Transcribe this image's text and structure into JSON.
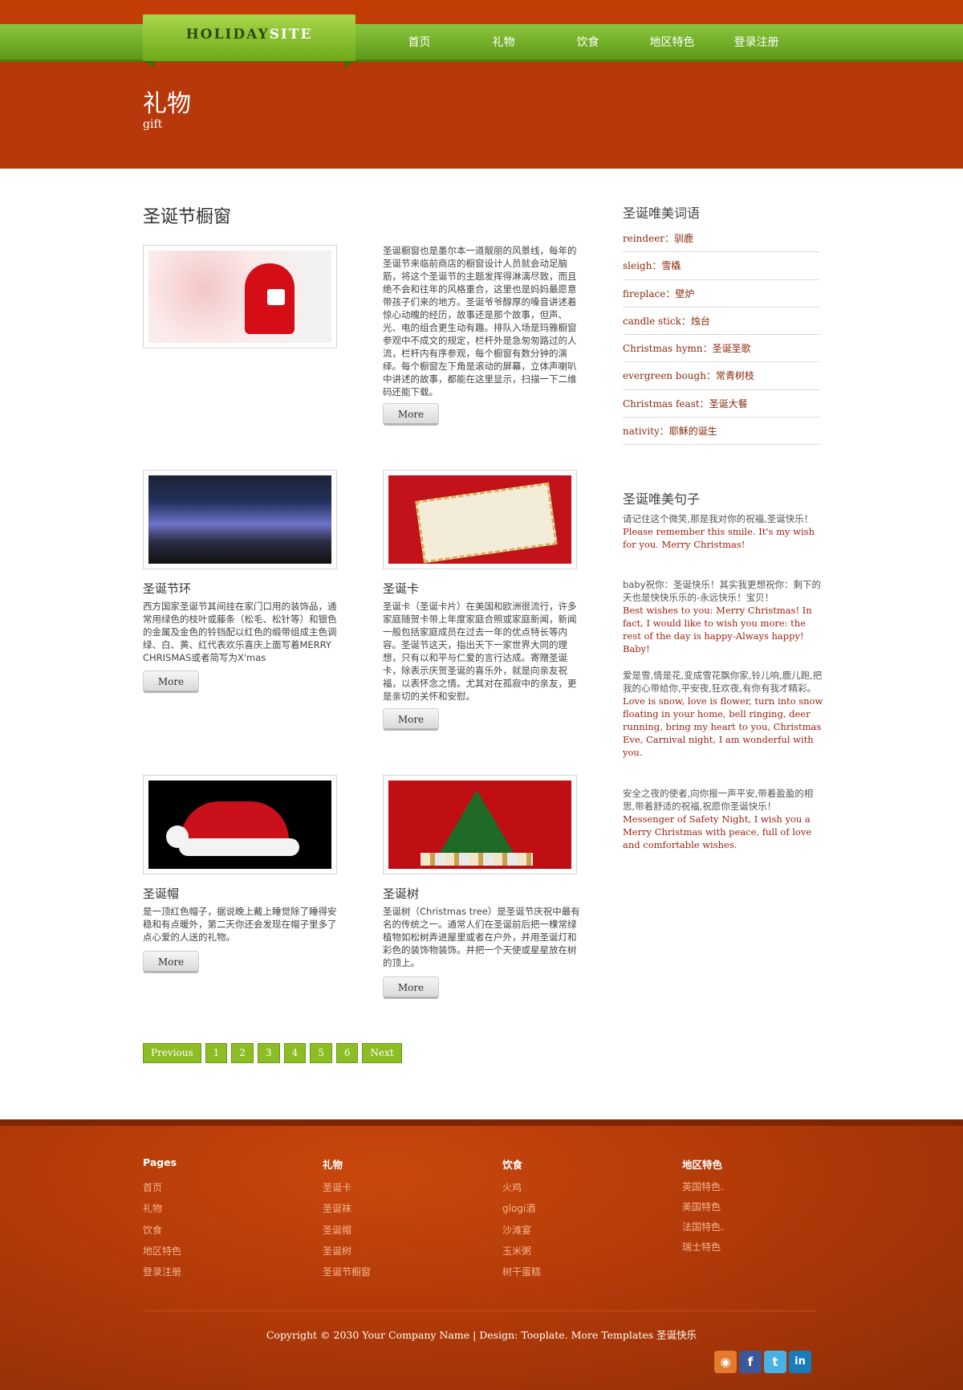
{
  "header": {
    "logo_part1": "HOLIDAY",
    "logo_part2": "SITE",
    "nav": [
      "首页",
      "礼物",
      "饮食",
      "地区特色",
      "登录注册"
    ],
    "page_title": "礼物",
    "page_subtitle": "gift"
  },
  "main": {
    "section_title": "圣诞节橱窗",
    "featured": {
      "text": "圣诞橱窗也是墨尔本一道靓丽的风景线，每年的圣诞节来临前商店的橱窗设计人员就会动足脑筋，将这个圣诞节的主题发挥得淋漓尽致，而且绝不会和往年的风格重合，这里也是妈妈最愿意带孩子们来的地方。圣诞爷爷醇厚的嗓音讲述着惊心动魄的经历，故事还是那个故事，但声、光、电的组合更生动有趣。排队入场是玛雅橱窗参观中不成文的规定，栏杆外是急匆匆路过的人流，栏杆内有序参观，每个橱窗有数分钟的演绎。每个橱窗左下角是滚动的屏幕，立体声喇叭中讲述的故事，都能在这里显示，扫描一下二维码还能下载。",
      "more": "More"
    },
    "items": [
      {
        "title": "圣诞节环",
        "text": "西方国家圣诞节其间挂在家门口用的装饰品，通常用绿色的枝叶或藤条（松毛、松针等）和银色的金属及金色的铃铛配以红色的缎带组成主色调绿、白、黄、红代表欢乐喜庆上面写着MERRY CHRISMAS或者简写为X'mas",
        "more": "More"
      },
      {
        "title": "圣诞卡",
        "text": "圣诞卡（圣诞卡片）在美国和欧洲很流行，许多家庭随贺卡带上年度家庭合照或家庭新闻，新闻一般包括家庭成员在过去一年的优点特长等内容。圣诞节这天，指出天下一家世界大同的理想，只有以和平与仁爱的言行达成。寄赠圣诞卡，除表示庆贺圣诞的喜乐外，就是向亲友祝福，以表怀念之情。尤其对在孤寂中的亲友，更是亲切的关怀和安慰。",
        "more": "More"
      },
      {
        "title": "圣诞帽",
        "text": "是一顶红色帽子，据说晚上戴上睡觉除了睡得安稳和有点暖外，第二天你还会发现在帽子里多了点心爱的人送的礼物。",
        "more": "More"
      },
      {
        "title": "圣诞树",
        "text": "圣诞树（Christmas tree）是圣诞节庆祝中最有名的传统之一。通常人们在圣诞前后把一棵常绿植物如松树弄进屋里或者在户外，并用圣诞灯和彩色的装饰物装饰。并把一个天使或星星放在树的顶上。",
        "more": "More"
      }
    ],
    "pagination": [
      "Previous",
      "1",
      "2",
      "3",
      "4",
      "5",
      "6",
      "Next"
    ]
  },
  "sidebar": {
    "vocab_title": "圣诞唯美词语",
    "vocab": [
      {
        "en": "reindeer：",
        "zh": "驯鹿"
      },
      {
        "en": "sleigh：",
        "zh": "雪橇"
      },
      {
        "en": "fireplace：",
        "zh": "壁炉"
      },
      {
        "en": "candle stick：",
        "zh": "烛台"
      },
      {
        "en": "Christmas hymn：",
        "zh": "圣诞圣歌"
      },
      {
        "en": "evergreen bough：",
        "zh": "常青树枝"
      },
      {
        "en": "Christmas feast：",
        "zh": "圣诞大餐"
      },
      {
        "en": "nativity：",
        "zh": "耶稣的诞生"
      }
    ],
    "quotes_title": "圣诞唯美句子",
    "quotes": [
      {
        "zh": "请记住这个微笑,那是我对你的祝福,圣诞快乐！",
        "en": "Please remember this smile. It's my wish for you. Merry Christmas!"
      },
      {
        "zh": "baby祝你：圣诞快乐！其实我更想祝你：剩下的天也是快快乐乐的-永远快乐！宝贝！",
        "en": "Best wishes to you: Merry Christmas! In fact, I would like to wish you more: the rest of the day is happy-Always happy! Baby!"
      },
      {
        "zh": "爱是雪,情是花,变成雪花飘你家,铃儿响,鹿儿跑,把我的心带给你,平安夜,狂欢夜,有你有我才精彩。",
        "en": "Love is snow, love is flower, turn into snow floating in your home, bell ringing, deer running, bring my heart to you, Christmas Eve, Carnival night, I am wonderful with you."
      },
      {
        "zh": "安全之夜的使者,向你报一声平安,带着盈盈的相思,带着舒适的祝福,祝愿你圣诞快乐！",
        "en": "Messenger of Safety Night, I wish you a Merry Christmas with peace, full of love and comfortable wishes."
      }
    ]
  },
  "footer": {
    "columns": [
      {
        "title": "Pages",
        "links": [
          "首页",
          "礼物",
          "饮食",
          "地区特色",
          "登录注册"
        ]
      },
      {
        "title": "礼物",
        "links": [
          "圣诞卡",
          "圣诞袜",
          "圣诞帽",
          "圣诞树",
          "圣诞节橱窗"
        ]
      },
      {
        "title": "饮食",
        "links": [
          "火鸡",
          "glogi酒",
          "沙滩宴",
          "玉米粥",
          "树干蛋糕"
        ]
      },
      {
        "title": "地区特色",
        "links": [
          "英国特色.",
          "美国特色",
          "法国特色.",
          "瑞士特色"
        ]
      }
    ],
    "copyright": "Copyright © 2030 Your Company Name | Design: Tooplate. More Templates 圣诞快乐",
    "social": [
      {
        "icon": "rss-icon",
        "glyph": "◉",
        "color": "#e5792e"
      },
      {
        "icon": "facebook-icon",
        "glyph": "f",
        "color": "#3b5998"
      },
      {
        "icon": "twitter-icon",
        "glyph": "t",
        "color": "#4ab1e6"
      },
      {
        "icon": "linkedin-icon",
        "glyph": "in",
        "color": "#1a7bbb"
      }
    ]
  }
}
